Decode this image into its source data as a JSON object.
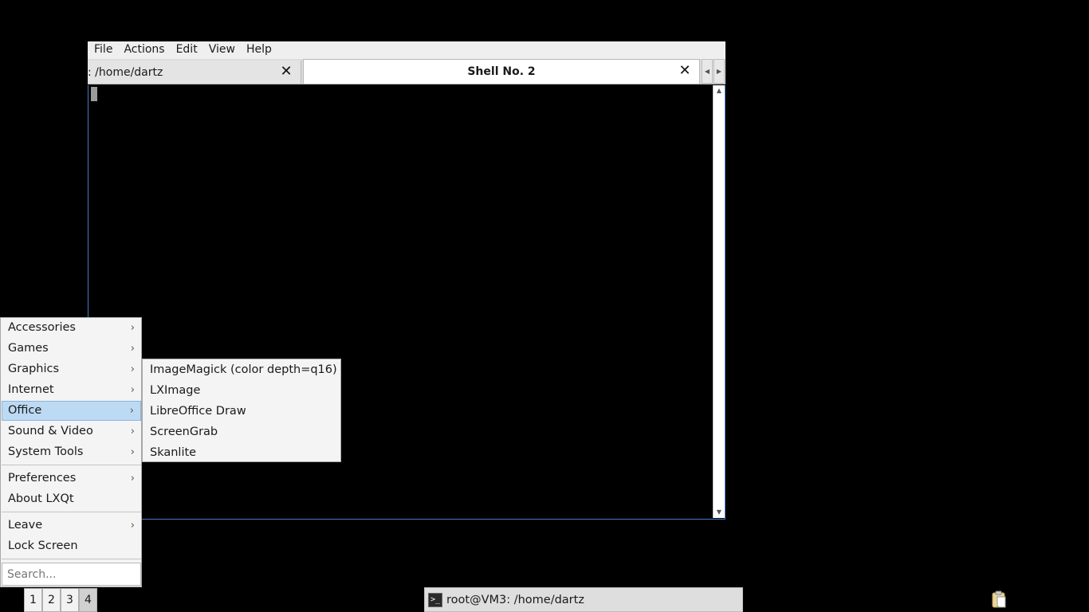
{
  "terminal": {
    "menu": [
      "File",
      "Actions",
      "Edit",
      "View",
      "Help"
    ],
    "tabs": [
      {
        "label": ": /home/dartz",
        "close": "✕"
      },
      {
        "label": "Shell No. 2",
        "close": "✕"
      }
    ]
  },
  "app_menu": {
    "items": [
      {
        "label": "Accessories",
        "submenu": true
      },
      {
        "label": "Games",
        "submenu": true
      },
      {
        "label": "Graphics",
        "submenu": true
      },
      {
        "label": "Internet",
        "submenu": true
      },
      {
        "label": "Office",
        "submenu": true,
        "active": true
      },
      {
        "label": "Sound & Video",
        "submenu": true
      },
      {
        "label": "System Tools",
        "submenu": true
      },
      {
        "label": "Preferences",
        "submenu": true
      },
      {
        "label": "About LXQt",
        "submenu": false
      },
      {
        "label": "Leave",
        "submenu": true
      },
      {
        "label": "Lock Screen",
        "submenu": false
      }
    ],
    "search_placeholder": "Search..."
  },
  "office_submenu": {
    "items": [
      "ImageMagick (color depth=q16)",
      "LXImage",
      "LibreOffice Draw",
      "ScreenGrab",
      "Skanlite"
    ]
  },
  "taskbar": {
    "desktops": [
      "1",
      "2",
      "3",
      "4"
    ],
    "active_desktop": "4",
    "task_label": "root@VM3: /home/dartz",
    "task_icon": "terminal-icon",
    "tray_icon": "clipboard-icon"
  },
  "colors": {
    "menu_highlight": "#bcdaf3",
    "window_border": "#4a7bc4",
    "desktop_bg": "#000000"
  }
}
